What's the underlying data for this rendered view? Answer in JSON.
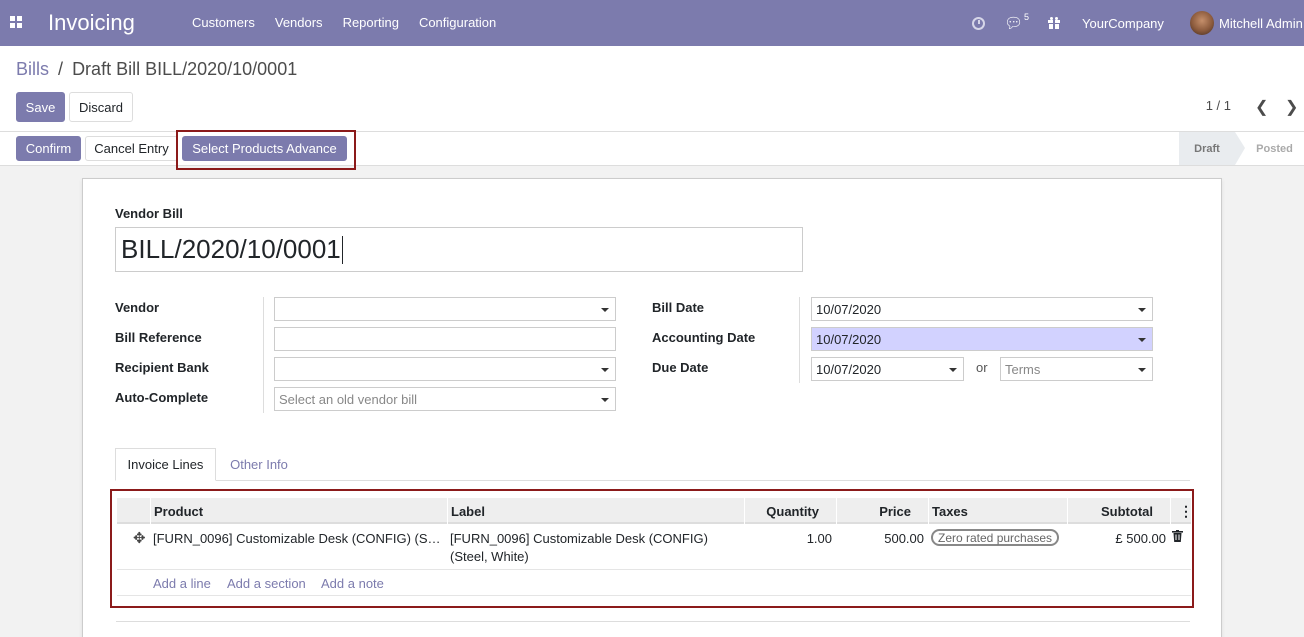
{
  "navbar": {
    "app_title": "Invoicing",
    "menu": [
      "Customers",
      "Vendors",
      "Reporting",
      "Configuration"
    ],
    "message_count": "5",
    "company": "YourCompany",
    "user": "Mitchell Admin"
  },
  "breadcrumb": {
    "parent": "Bills",
    "separator": "/",
    "current": "Draft Bill BILL/2020/10/0001"
  },
  "toolbar": {
    "save_label": "Save",
    "discard_label": "Discard",
    "pager": "1 / 1"
  },
  "header_buttons": {
    "confirm_label": "Confirm",
    "cancel_label": "Cancel Entry",
    "select_products_label": "Select Products Advance"
  },
  "statusbar": {
    "stages": [
      "Draft",
      "Posted"
    ],
    "active": "Draft"
  },
  "form": {
    "type_label": "Vendor Bill",
    "name": "BILL/2020/10/0001",
    "left_fields": [
      {
        "label": "Vendor",
        "value": "",
        "placeholder": ""
      },
      {
        "label": "Bill Reference",
        "value": "",
        "placeholder": ""
      },
      {
        "label": "Recipient Bank",
        "value": "",
        "placeholder": ""
      },
      {
        "label": "Auto-Complete",
        "value": "",
        "placeholder": "Select an old vendor bill"
      }
    ],
    "right_fields": {
      "bill_date_label": "Bill Date",
      "bill_date": "10/07/2020",
      "accounting_date_label": "Accounting Date",
      "accounting_date": "10/07/2020",
      "due_date_label": "Due Date",
      "due_date": "10/07/2020",
      "or_label": "or",
      "terms_placeholder": "Terms"
    }
  },
  "tabs": [
    "Invoice Lines",
    "Other Info"
  ],
  "invoice_lines": {
    "columns": [
      "Product",
      "Label",
      "Quantity",
      "Price",
      "Taxes",
      "Subtotal"
    ],
    "rows": [
      {
        "product": "[FURN_0096] Customizable Desk (CONFIG) (S…",
        "label_line1": "[FURN_0096] Customizable Desk (CONFIG)",
        "label_line2": "(Steel, White)",
        "quantity": "1.00",
        "price": "500.00",
        "tax": "Zero rated purchases",
        "subtotal": "£ 500.00"
      }
    ],
    "add_links": [
      "Add a line",
      "Add a section",
      "Add a note"
    ]
  },
  "colors": {
    "brand": "#7c7bad",
    "highlight": "#8b1a1a",
    "accounting_date_bg": "#d2d2ff"
  }
}
